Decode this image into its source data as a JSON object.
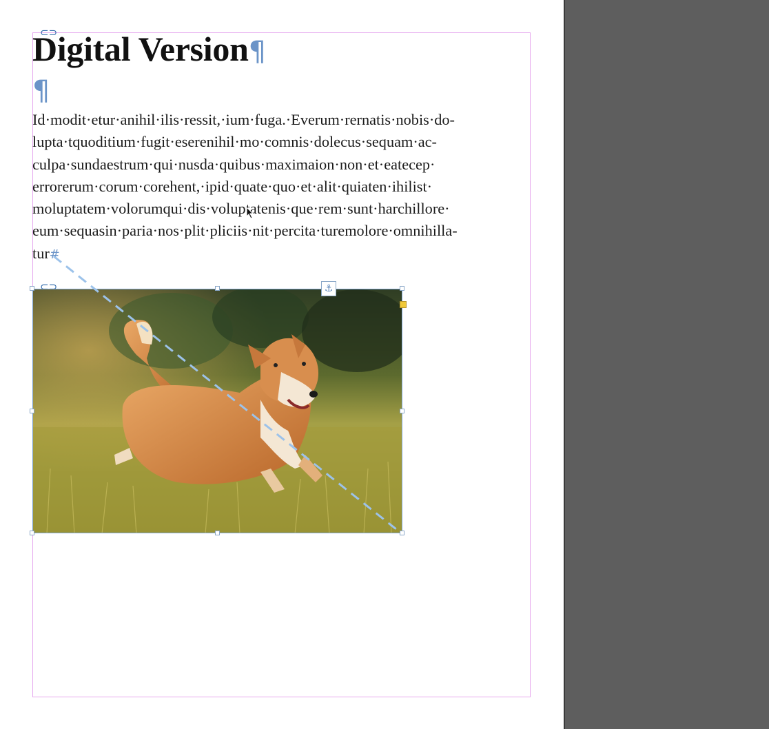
{
  "document": {
    "title": "Digital Version",
    "body_lines": [
      "Id·modit·etur·anihil·ilis·ressit,·ium·fuga.·Everum·rernatis·nobis·do-",
      "lupta·tquoditium·fugit·eserenihil·mo·comnis·dolecus·sequam·ac-",
      "culpa·sundaestrum·qui·nusda·quibus·maximaion·non·et·eatecep·",
      "errorerum·corum·corehent,·ipid·quate·quo·et·alit·quiaten·ihilist·",
      "moluptatem·volorumqui·dis·voluptatenis·que·rem·sunt·harchillore·",
      "eum·sequasin·paria·nos·plit·pliciis·nit·percita·turemolore·omnihilla-",
      "tur"
    ],
    "pilcrow": "¶",
    "end_of_story": "#"
  },
  "image": {
    "subject": "corgi-running-in-grass"
  },
  "colors": {
    "margin_guide": "#e6a8ee",
    "hidden_chars": "#6b94c8",
    "pasteboard": "#5e5e5e",
    "frame_edge": "#7fa7d6"
  }
}
